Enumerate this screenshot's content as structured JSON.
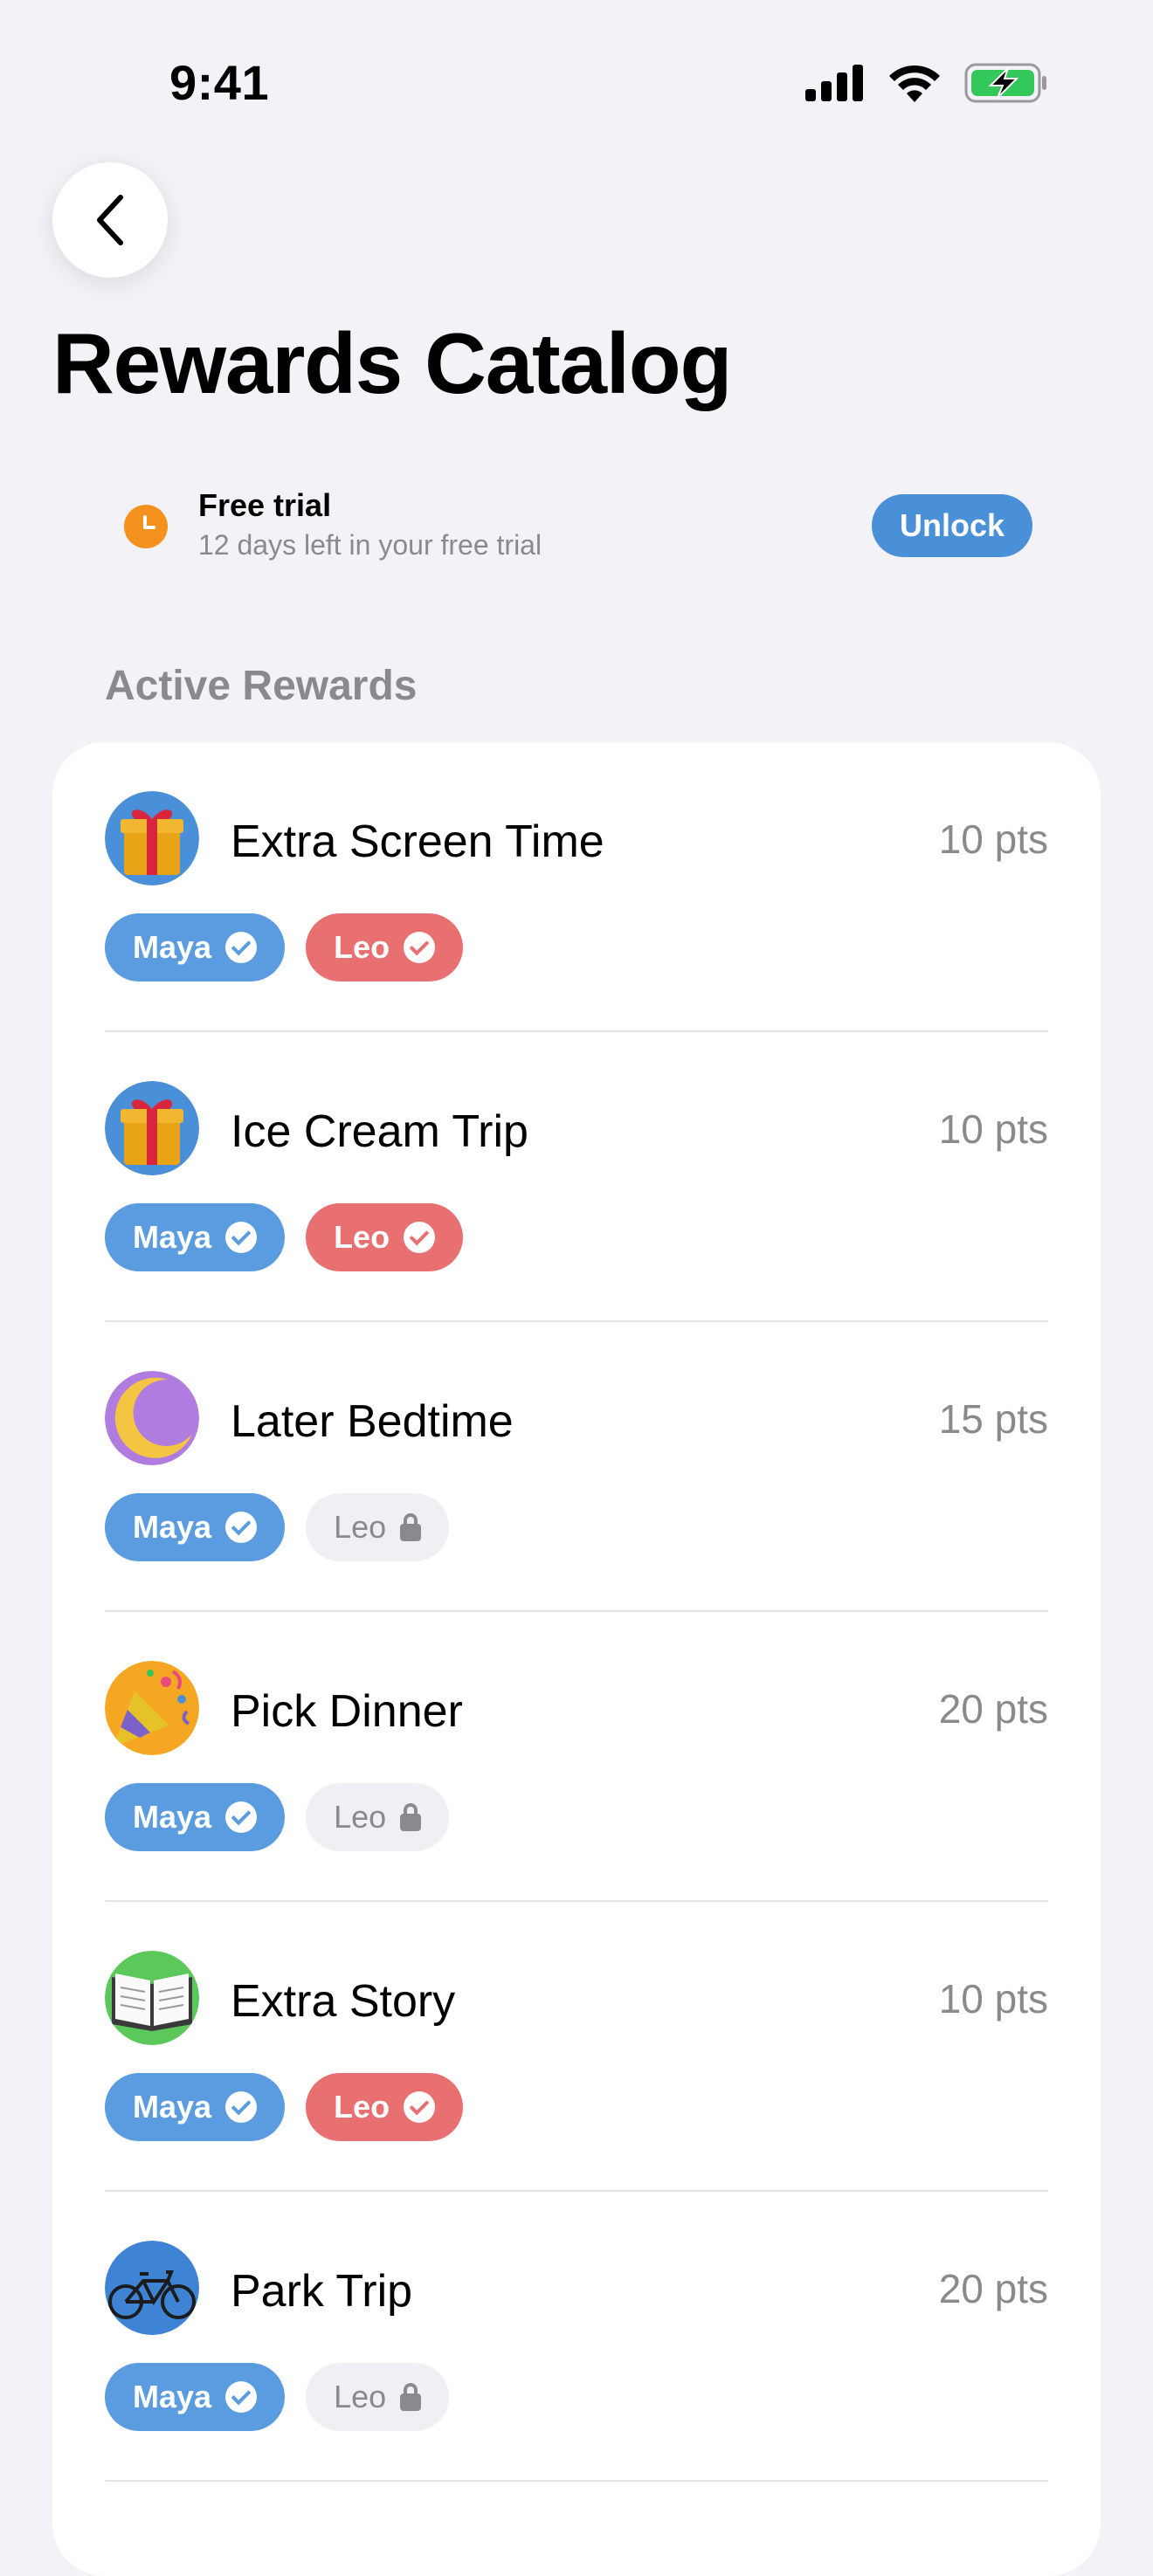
{
  "status_bar": {
    "time": "9:41"
  },
  "header": {
    "title": "Rewards Catalog"
  },
  "trial": {
    "title": "Free trial",
    "subtitle": "12 days left in your free trial",
    "button": "Unlock"
  },
  "section": {
    "title": "Active Rewards"
  },
  "colors": {
    "accent": "#4A90D9",
    "maya": "#5B9BDF",
    "leo": "#E87070",
    "trial_clock": "#F5921E"
  },
  "rewards": [
    {
      "title": "Extra Screen Time",
      "points": "10 pts",
      "icon": "gift-icon",
      "kids": [
        {
          "name": "Maya",
          "state": "enabled"
        },
        {
          "name": "Leo",
          "state": "enabled"
        }
      ]
    },
    {
      "title": "Ice Cream Trip",
      "points": "10 pts",
      "icon": "gift-icon",
      "kids": [
        {
          "name": "Maya",
          "state": "enabled"
        },
        {
          "name": "Leo",
          "state": "enabled"
        }
      ]
    },
    {
      "title": "Later Bedtime",
      "points": "15 pts",
      "icon": "moon-icon",
      "kids": [
        {
          "name": "Maya",
          "state": "enabled"
        },
        {
          "name": "Leo",
          "state": "locked"
        }
      ]
    },
    {
      "title": "Pick Dinner",
      "points": "20 pts",
      "icon": "party-popper-icon",
      "kids": [
        {
          "name": "Maya",
          "state": "enabled"
        },
        {
          "name": "Leo",
          "state": "locked"
        }
      ]
    },
    {
      "title": "Extra Story",
      "points": "10 pts",
      "icon": "book-icon",
      "kids": [
        {
          "name": "Maya",
          "state": "enabled"
        },
        {
          "name": "Leo",
          "state": "enabled"
        }
      ]
    },
    {
      "title": "Park Trip",
      "points": "20 pts",
      "icon": "bicycle-icon",
      "kids": [
        {
          "name": "Maya",
          "state": "enabled"
        },
        {
          "name": "Leo",
          "state": "locked"
        }
      ]
    }
  ]
}
